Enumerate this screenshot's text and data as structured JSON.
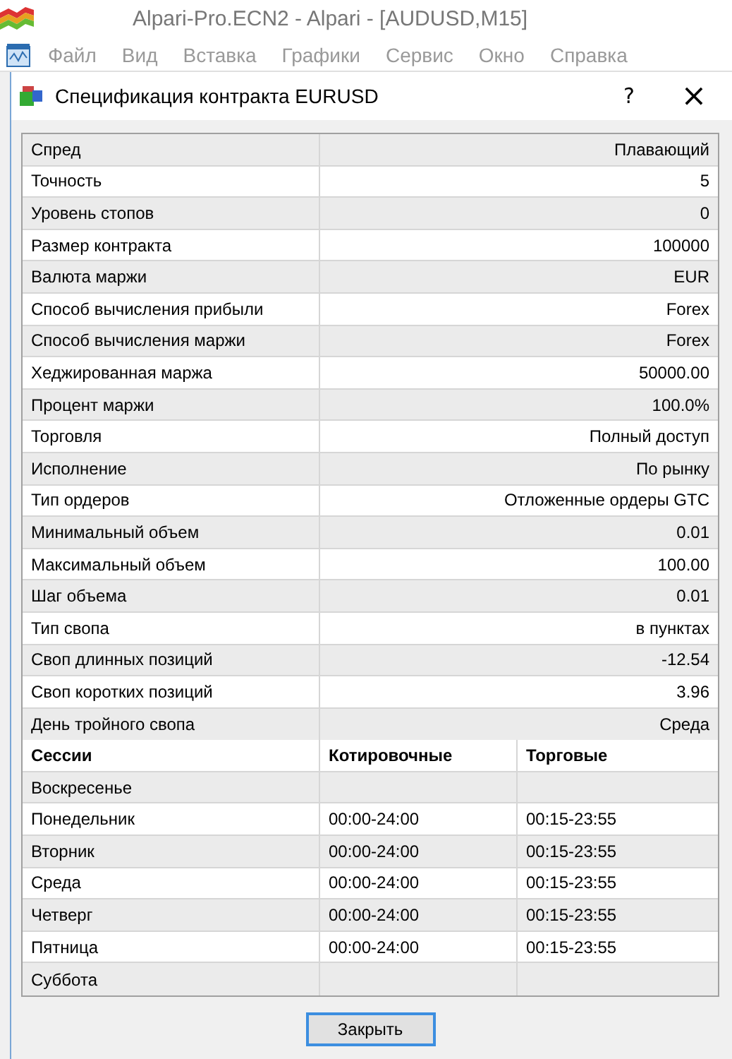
{
  "app_window": {
    "title": "Alpari-Pro.ECN2 - Alpari - [AUDUSD,M15]"
  },
  "menu_bar": [
    "Файл",
    "Вид",
    "Вставка",
    "Графики",
    "Сервис",
    "Окно",
    "Справка"
  ],
  "dialog": {
    "title": "Спецификация контракта EURUSD",
    "help": "?",
    "close": "×"
  },
  "specification": [
    {
      "label": "Спред",
      "value": "Плавающий"
    },
    {
      "label": "Точность",
      "value": "5"
    },
    {
      "label": "Уровень стопов",
      "value": "0"
    },
    {
      "label": "Размер контракта",
      "value": "100000"
    },
    {
      "label": "Валюта маржи",
      "value": "EUR"
    },
    {
      "label": "Способ вычисления прибыли",
      "value": "Forex"
    },
    {
      "label": "Способ вычисления маржи",
      "value": "Forex"
    },
    {
      "label": "Хеджированная маржа",
      "value": "50000.00"
    },
    {
      "label": "Процент маржи",
      "value": "100.0%"
    },
    {
      "label": "Торговля",
      "value": "Полный доступ"
    },
    {
      "label": "Исполнение",
      "value": "По рынку"
    },
    {
      "label": "Тип ордеров",
      "value": "Отложенные ордеры GTC"
    },
    {
      "label": "Минимальный объем",
      "value": "0.01"
    },
    {
      "label": "Максимальный объем",
      "value": "100.00"
    },
    {
      "label": "Шаг объема",
      "value": "0.01"
    },
    {
      "label": "Тип свопа",
      "value": "в пунктах"
    },
    {
      "label": "Своп длинных позиций",
      "value": "-12.54"
    },
    {
      "label": "Своп коротких позиций",
      "value": "3.96"
    },
    {
      "label": "День тройного свопа",
      "value": "Среда"
    }
  ],
  "sessions": {
    "columns": [
      "Сессии",
      "Котировочные",
      "Торговые"
    ],
    "rows": [
      {
        "day": "Воскресенье"
      },
      {
        "day": "Понедельник",
        "quotes": "00:00-24:00",
        "trades": "00:15-23:55"
      },
      {
        "day": "Вторник",
        "quotes": "00:00-24:00",
        "trades": "00:15-23:55"
      },
      {
        "day": "Среда",
        "quotes": "00:00-24:00",
        "trades": "00:15-23:55"
      },
      {
        "day": "Четверг",
        "quotes": "00:00-24:00",
        "trades": "00:15-23:55"
      },
      {
        "day": "Пятница",
        "quotes": "00:00-24:00",
        "trades": "00:15-23:55"
      },
      {
        "day": "Суббота"
      }
    ]
  },
  "buttons": [
    "Закрыть"
  ]
}
